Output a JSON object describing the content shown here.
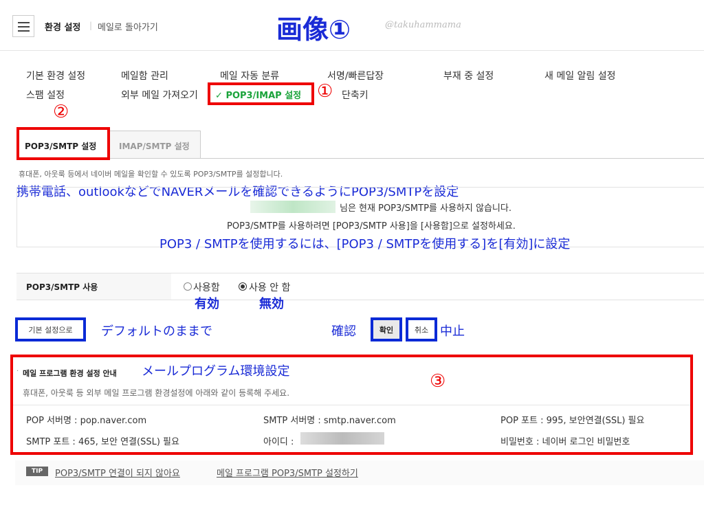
{
  "header": {
    "title": "환경 설정",
    "separator": "|",
    "back": "메일로 돌아가기",
    "annotation_title": "画像①",
    "watermark": "@takuhammama"
  },
  "nav": {
    "row1": [
      "기본 환경 설정",
      "메일함 관리",
      "메일 자동 분류",
      "서명/빠른답장",
      "부재 중 설정",
      "새 메일 알림 설정"
    ],
    "row2": [
      "스팸 설정",
      "외부 메일 가져오기"
    ],
    "active_check": "✓",
    "active": "POP3/IMAP 설정",
    "shortcut": "단축키",
    "marker1": "①"
  },
  "tabs": {
    "marker2": "②",
    "tab1": "POP3/SMTP 설정",
    "tab2": "IMAP/SMTP 설정"
  },
  "info": {
    "desc": "휴대폰, 아웃룩 등에서 네이버 메일을 확인할 수 있도록 POP3/SMTP를 설정합니다.",
    "ann_desc": "携帯電話、outlookなどでNAVERメールを確認できるようにPOP3/SMTPを設定",
    "status": "님은 현재 POP3/SMTP를 사용하지 않습니다.",
    "instruction": "POP3/SMTP를 사용하려면 [POP3/SMTP 사용]을 [사용함]으로 설정하세요.",
    "ann_instruction": "POP3 / SMTPを使用するには、[POP3 / SMTPを使用する]を[有効]に設定"
  },
  "usage": {
    "label": "POP3/SMTP 사용",
    "on": "사용함",
    "off": "사용 안 함",
    "ann_on": "有効",
    "ann_off": "無効"
  },
  "buttons": {
    "default": "기본 설정으로",
    "ann_default": "デフォルトのままで",
    "ann_ok": "確認",
    "ok": "확인",
    "cancel": "취소",
    "ann_cancel": "中止"
  },
  "guide": {
    "title": "메일 프로그램 환경 설정 안내",
    "ann_title": "メールプログラム環境設定",
    "marker3": "③",
    "desc": "휴대폰, 아웃룩 등 외부 메일 프로그램 환경설정에 아래와 같이 등록해 주세요.",
    "pop_server": "POP 서버명 : pop.naver.com",
    "smtp_server": "SMTP 서버명 : smtp.naver.com",
    "pop_port": "POP 포트 : 995, 보안연결(SSL) 필요",
    "smtp_port": "SMTP 포트 : 465, 보안 연결(SSL) 필요",
    "id_label": "아이디 :",
    "password": "비밀번호 : 네이버 로그인 비밀번호"
  },
  "tip": {
    "badge": "TIP",
    "link1": "POP3/SMTP 연결이 되지 않아요",
    "link2": "메일 프로그램 POP3/SMTP 설정하기"
  },
  "colors": {
    "annotation_red": "#e00000",
    "annotation_blue": "#1a2bd6",
    "active_green": "#1aa33a"
  }
}
